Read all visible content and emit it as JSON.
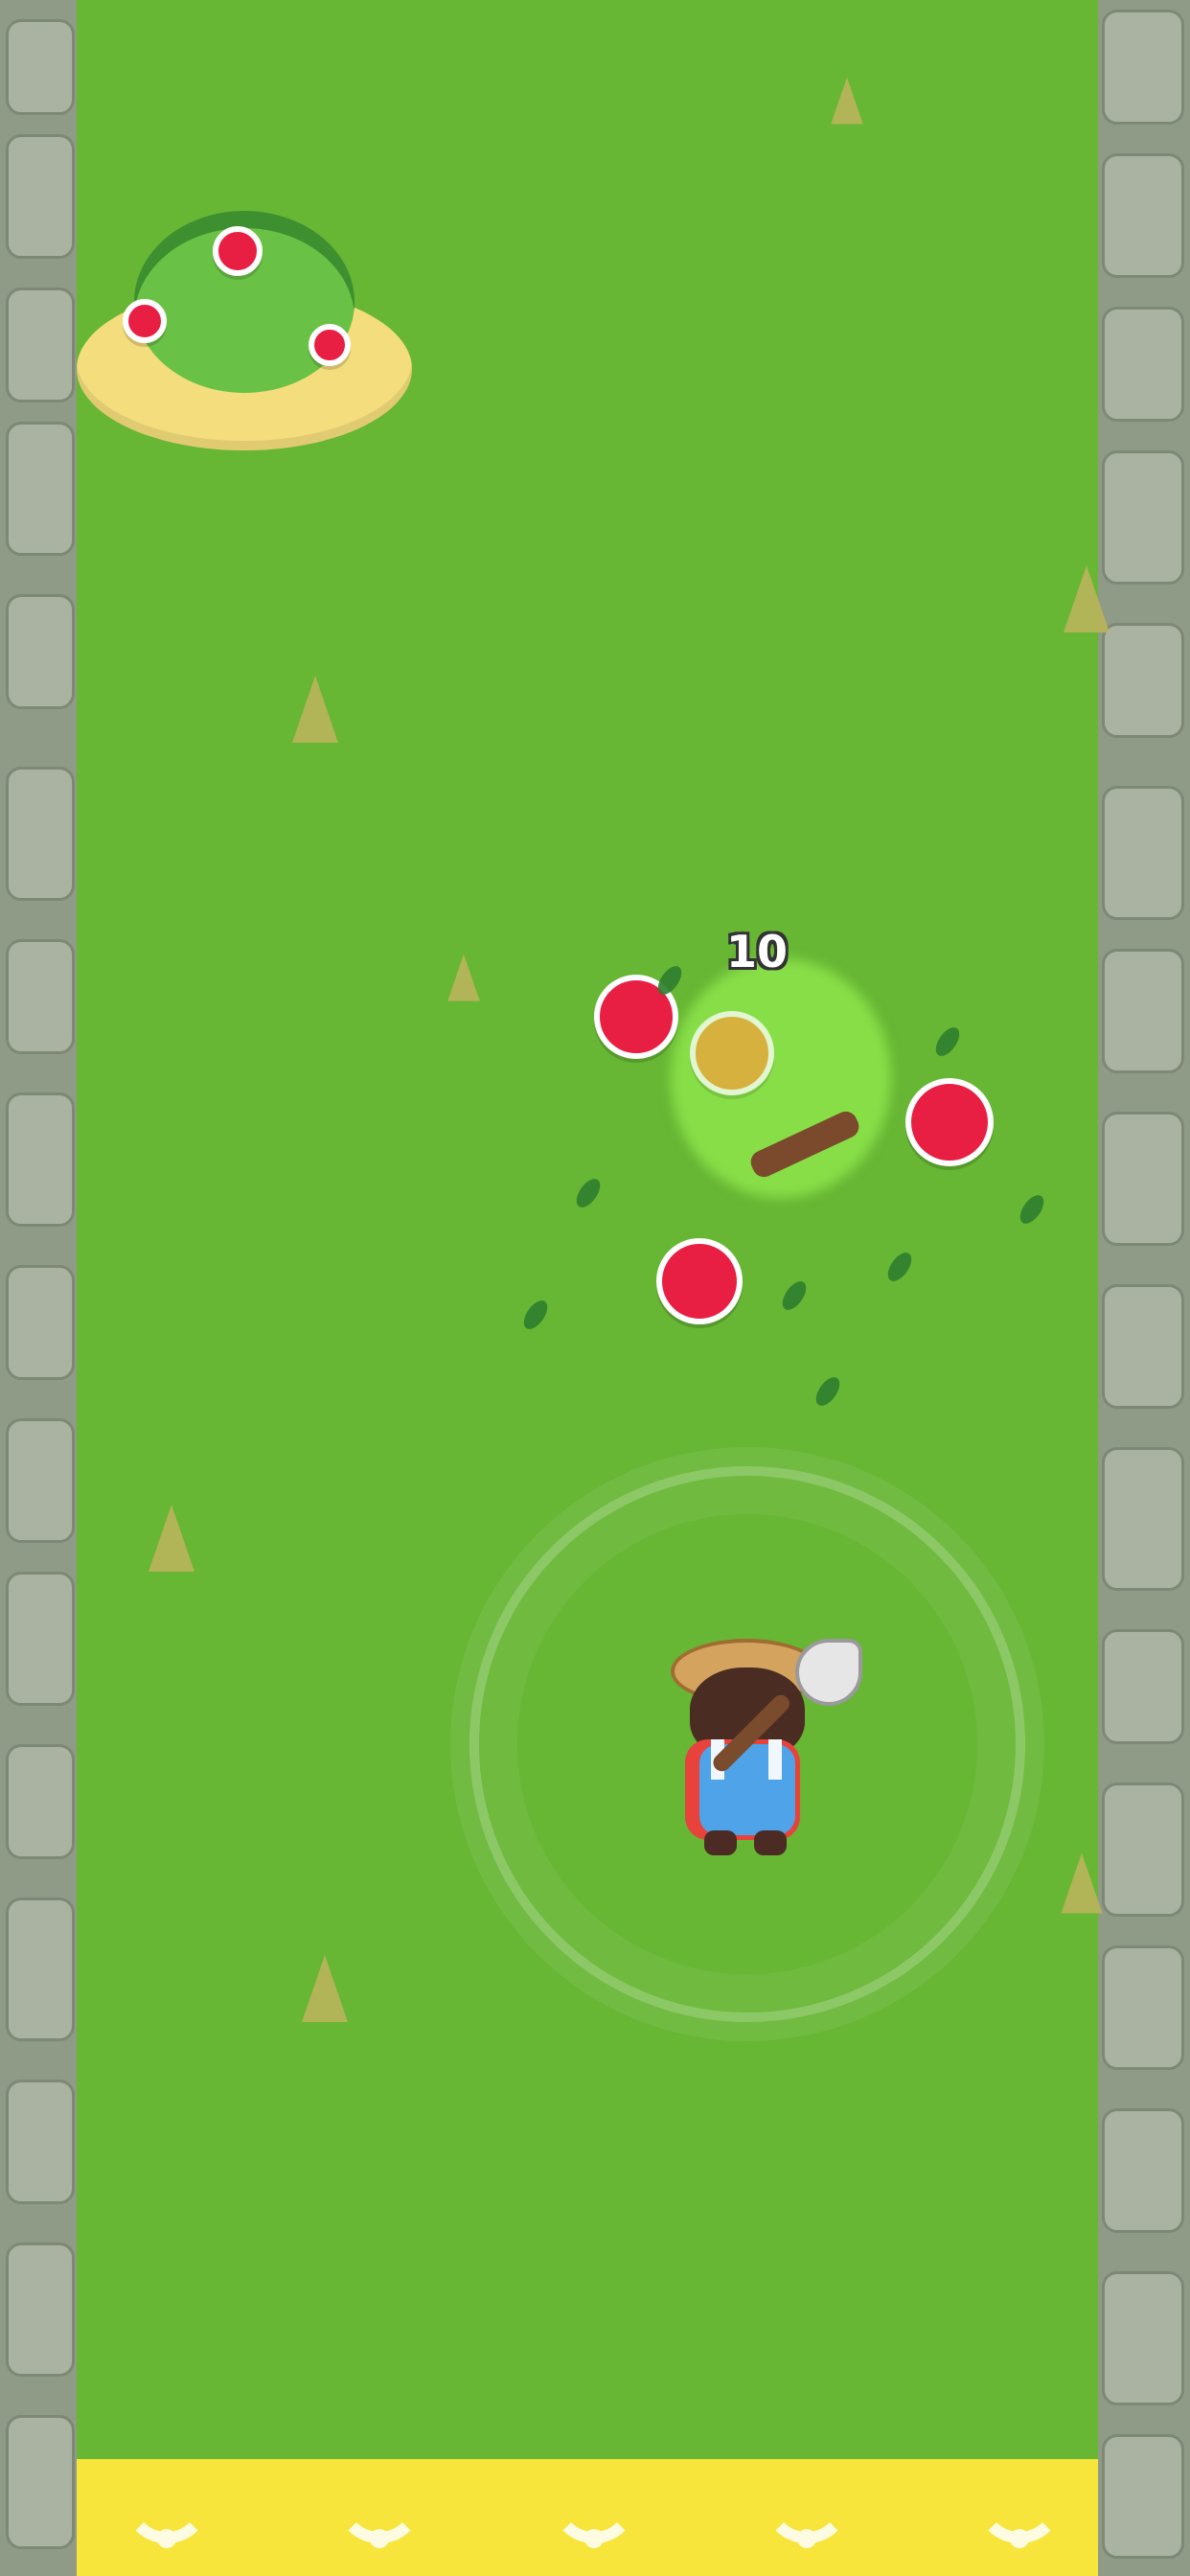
{
  "game": {
    "floating_score": "10"
  },
  "ui": {
    "bottom_bar": {
      "chevrons": [
        {
          "icon": "chevron-up-icon"
        },
        {
          "icon": "chevron-up-icon"
        },
        {
          "icon": "chevron-up-icon"
        },
        {
          "icon": "chevron-up-icon"
        },
        {
          "icon": "chevron-up-icon"
        }
      ]
    }
  },
  "colors": {
    "grass": "#67b634",
    "bottom_bar": "#f7e53c",
    "berry": "#e81f42"
  }
}
